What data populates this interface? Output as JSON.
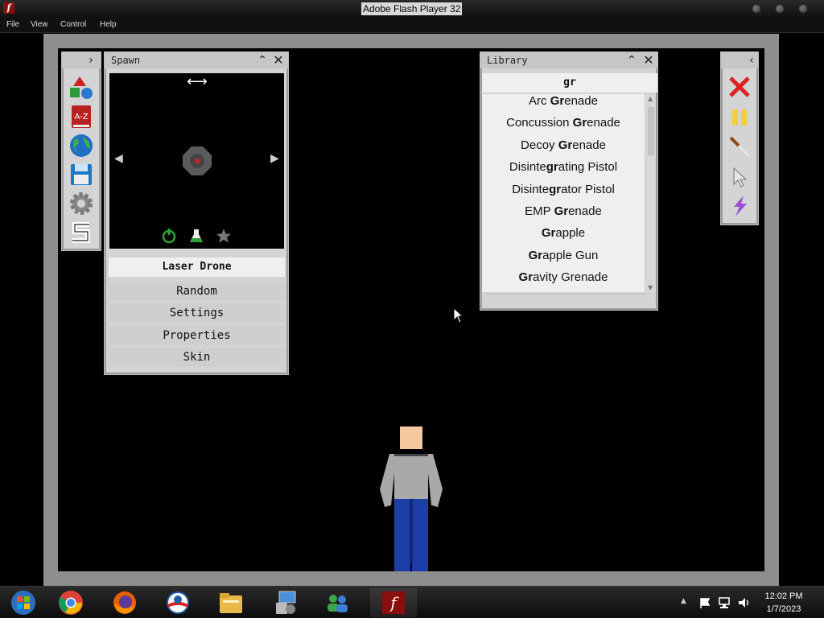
{
  "window": {
    "title": "Adobe Flash Player 32"
  },
  "menu": [
    "File",
    "View",
    "Control",
    "Help"
  ],
  "spawn_panel": {
    "title": "Spawn",
    "selected_item": "Laser Drone",
    "buttons": [
      "Random",
      "Settings",
      "Properties",
      "Skin"
    ]
  },
  "library_panel": {
    "title": "Library",
    "search": "gr",
    "items": [
      {
        "pre": "Arc ",
        "hl": "Gr",
        "post": "enade"
      },
      {
        "pre": "Concussion ",
        "hl": "Gr",
        "post": "enade"
      },
      {
        "pre": "Decoy ",
        "hl": "Gr",
        "post": "enade"
      },
      {
        "pre": "Disinte",
        "hl": "gr",
        "post": "ating Pistol"
      },
      {
        "pre": "Disinte",
        "hl": "gr",
        "post": "ator Pistol"
      },
      {
        "pre": "EMP ",
        "hl": "Gr",
        "post": "enade"
      },
      {
        "pre": "",
        "hl": "Gr",
        "post": "apple"
      },
      {
        "pre": "",
        "hl": "Gr",
        "post": "apple Gun"
      },
      {
        "pre": "",
        "hl": "Gr",
        "post": "avity Grenade"
      }
    ]
  },
  "clock": {
    "time": "12:02 PM",
    "date": "1/7/2023"
  },
  "colors": {
    "stage_frame": "#8e8e8e",
    "panel": "#d4d4d4",
    "accent_red": "#cc2222"
  }
}
